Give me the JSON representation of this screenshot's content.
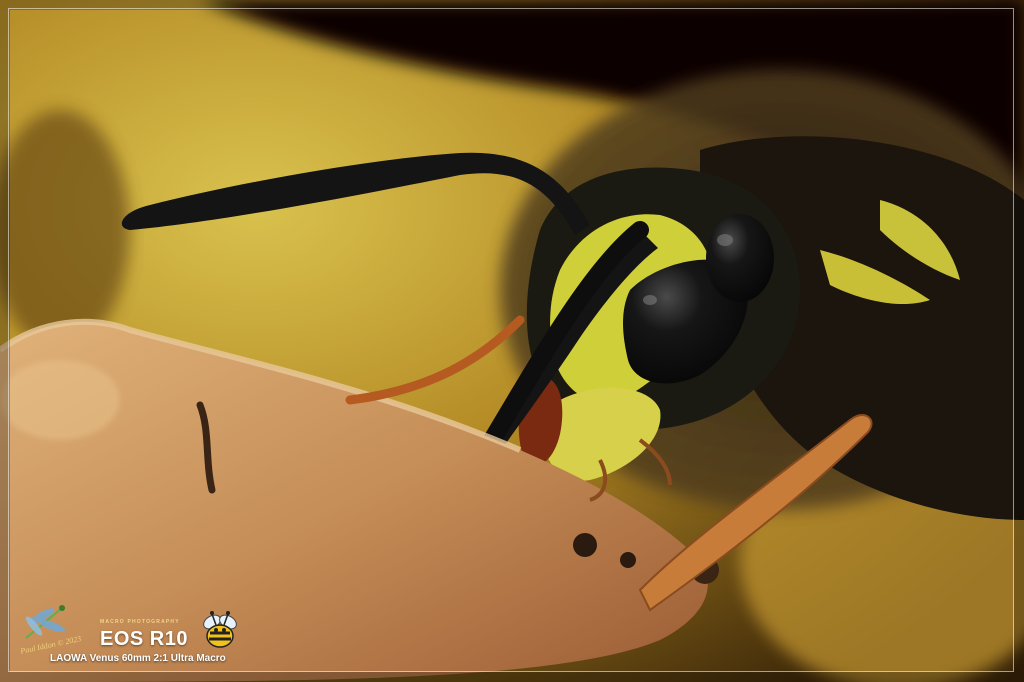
{
  "watermark": {
    "author": "Paul Iddon © 2023",
    "tagline": "MACRO PHOTOGRAPHY",
    "camera": "EOS R10",
    "lens": "LAOWA Venus 60mm 2:1 Ultra Macro"
  },
  "icons": [
    "dragonfly-logo",
    "bee-logo"
  ],
  "colors": {
    "background_yellow": "#c9a63a",
    "wasp_yellow": "#d8d23a",
    "wasp_black": "#141414",
    "apple_flesh": "#c89a62"
  }
}
